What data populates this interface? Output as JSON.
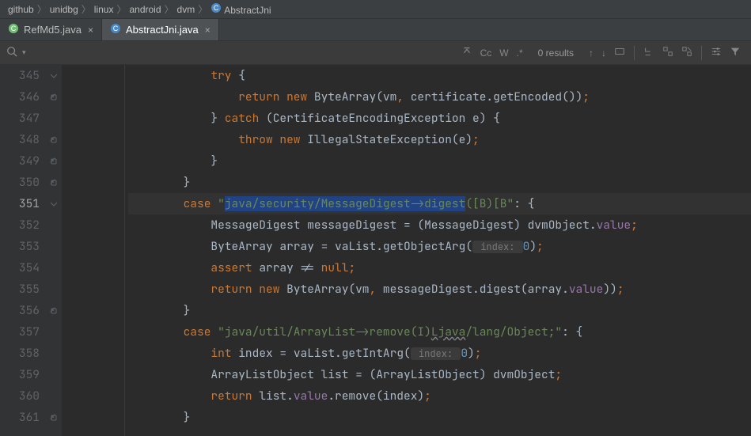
{
  "breadcrumb": {
    "items": [
      "github",
      "unidbg",
      "linux",
      "android",
      "dvm"
    ],
    "leaf": "AbstractJni",
    "leafIcon": "class-icon"
  },
  "tabs": [
    {
      "label": "RefMd5.java",
      "icon": "java-class-icon",
      "iconColor": "#6fbf73",
      "active": false
    },
    {
      "label": "AbstractJni.java",
      "icon": "java-class-icon",
      "iconColor": "#4a88c7",
      "active": true
    }
  ],
  "findbar": {
    "results": "0 results",
    "cc": "Cc",
    "word": "W"
  },
  "gutter": {
    "start": 345,
    "end": 361,
    "current": 351
  },
  "code": {
    "lines": [
      {
        "ind": 3,
        "tokens": [
          {
            "t": "try ",
            "c": "kw"
          },
          {
            "t": "{"
          }
        ]
      },
      {
        "ind": 4,
        "tokens": [
          {
            "t": "return new ",
            "c": "kw"
          },
          {
            "t": "ByteArray(vm"
          },
          {
            "t": ", ",
            "c": "kw"
          },
          {
            "t": "certificate.getEncoded())"
          },
          {
            "t": ";",
            "c": "kw"
          }
        ]
      },
      {
        "ind": 3,
        "tokens": [
          {
            "t": "} "
          },
          {
            "t": "catch ",
            "c": "kw"
          },
          {
            "t": "(CertificateEncodingException e) {"
          }
        ]
      },
      {
        "ind": 4,
        "tokens": [
          {
            "t": "throw new ",
            "c": "kw"
          },
          {
            "t": "IllegalStateException(e)"
          },
          {
            "t": ";",
            "c": "kw"
          }
        ]
      },
      {
        "ind": 3,
        "tokens": [
          {
            "t": "}"
          }
        ]
      },
      {
        "ind": 2,
        "tokens": [
          {
            "t": "}"
          }
        ]
      },
      {
        "ind": 2,
        "hl": true,
        "tokens": [
          {
            "t": "case ",
            "c": "kw"
          },
          {
            "t": "\"",
            "c": "str"
          },
          {
            "t": "java/security/MessageDigest->digest",
            "c": "str sel"
          },
          {
            "t": "([B)[B\"",
            "c": "str"
          },
          {
            "t": ": {"
          }
        ]
      },
      {
        "ind": 3,
        "tokens": [
          {
            "t": "MessageDigest messageDigest = (MessageDigest) dvmObject."
          },
          {
            "t": "value",
            "c": "fld"
          },
          {
            "t": ";",
            "c": "kw"
          }
        ]
      },
      {
        "ind": 3,
        "tokens": [
          {
            "t": "ByteArray array = vaList.getObjectArg("
          },
          {
            "t": " index: ",
            "c": "hint"
          },
          {
            "t": "0",
            "c": "num"
          },
          {
            "t": ")"
          },
          {
            "t": ";",
            "c": "kw"
          }
        ]
      },
      {
        "ind": 3,
        "tokens": [
          {
            "t": "assert ",
            "c": "kw"
          },
          {
            "t": "array != "
          },
          {
            "t": "null",
            "c": "kw"
          },
          {
            "t": ";",
            "c": "kw"
          }
        ]
      },
      {
        "ind": 3,
        "tokens": [
          {
            "t": "return new ",
            "c": "kw"
          },
          {
            "t": "ByteArray(vm"
          },
          {
            "t": ", ",
            "c": "kw"
          },
          {
            "t": "messageDigest.digest(array."
          },
          {
            "t": "value",
            "c": "fld"
          },
          {
            "t": "))"
          },
          {
            "t": ";",
            "c": "kw"
          }
        ]
      },
      {
        "ind": 2,
        "tokens": [
          {
            "t": "}"
          }
        ]
      },
      {
        "ind": 2,
        "tokens": [
          {
            "t": "case ",
            "c": "kw"
          },
          {
            "t": "\"java/util/ArrayList->remove(I)",
            "c": "str"
          },
          {
            "t": "Ljava",
            "c": "str wavy"
          },
          {
            "t": "/lang/Object;\"",
            "c": "str"
          },
          {
            "t": ": {"
          }
        ]
      },
      {
        "ind": 3,
        "tokens": [
          {
            "t": "int ",
            "c": "kw"
          },
          {
            "t": "index = vaList.getIntArg("
          },
          {
            "t": " index: ",
            "c": "hint"
          },
          {
            "t": "0",
            "c": "num"
          },
          {
            "t": ")"
          },
          {
            "t": ";",
            "c": "kw"
          }
        ]
      },
      {
        "ind": 3,
        "tokens": [
          {
            "t": "ArrayListObject list = (ArrayListObject) dvmObject"
          },
          {
            "t": ";",
            "c": "kw"
          }
        ]
      },
      {
        "ind": 3,
        "tokens": [
          {
            "t": "return ",
            "c": "kw"
          },
          {
            "t": "list."
          },
          {
            "t": "value",
            "c": "fld"
          },
          {
            "t": ".remove(index)"
          },
          {
            "t": ";",
            "c": "kw"
          }
        ]
      },
      {
        "ind": 2,
        "tokens": [
          {
            "t": "}"
          }
        ]
      }
    ]
  }
}
